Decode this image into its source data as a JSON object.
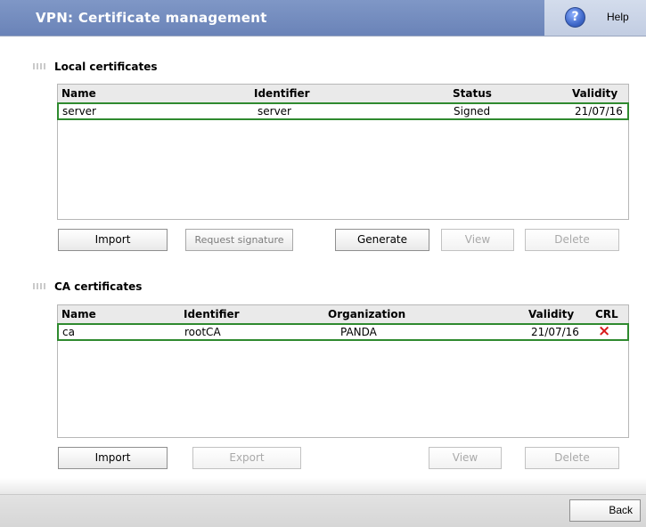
{
  "header": {
    "title": "VPN: Certificate management",
    "help_icon_glyph": "?",
    "help_label": "Help"
  },
  "local": {
    "heading": "Local certificates",
    "columns": [
      "Name",
      "Identifier",
      "Status",
      "Validity"
    ],
    "rows": [
      {
        "name": "server",
        "identifier": "server",
        "status": "Signed",
        "validity": "21/07/16"
      }
    ],
    "buttons": {
      "import": "Import",
      "request_signature": "Request signature",
      "generate": "Generate",
      "view": "View",
      "delete": "Delete"
    }
  },
  "ca": {
    "heading": "CA certificates",
    "columns": [
      "Name",
      "Identifier",
      "Organization",
      "Validity",
      "CRL"
    ],
    "rows": [
      {
        "name": "ca",
        "identifier": "rootCA",
        "organization": "PANDA",
        "validity": "21/07/16",
        "crl_icon": "×"
      }
    ],
    "buttons": {
      "import": "Import",
      "export": "Export",
      "view": "View",
      "delete": "Delete"
    }
  },
  "footer": {
    "back": "Back"
  },
  "colors": {
    "header_title_bg": "#7088bb",
    "selected_row_border": "#2f8a2f",
    "crl_icon": "#d81b1b"
  },
  "icons": {
    "help": "question-circle-icon",
    "crl": "red-x-icon",
    "grip": "grip-icon"
  }
}
